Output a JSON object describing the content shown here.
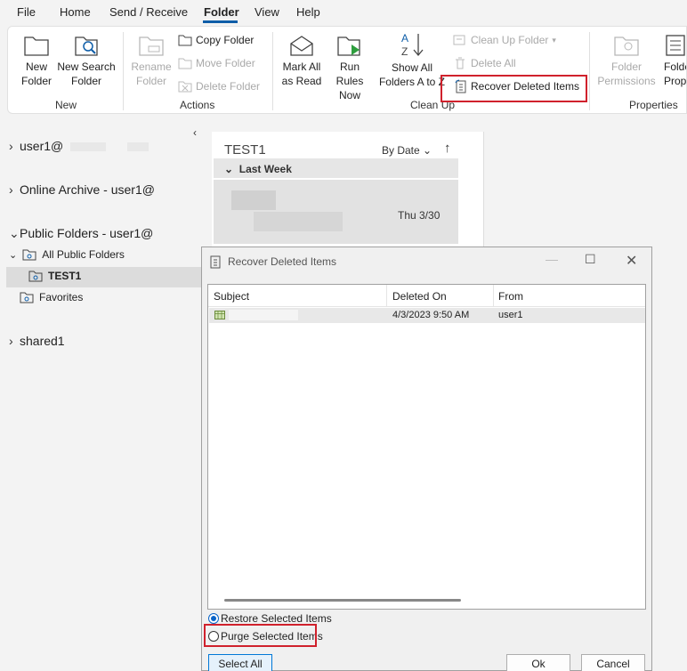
{
  "menu": {
    "items": [
      "File",
      "Home",
      "Send / Receive",
      "Folder",
      "View",
      "Help"
    ],
    "active": "Folder"
  },
  "ribbon": {
    "new_group": {
      "new_folder": [
        "New",
        "Folder"
      ],
      "new_search_folder": [
        "New Search",
        "Folder"
      ],
      "label": "New"
    },
    "actions_group": {
      "rename_folder": [
        "Rename",
        "Folder"
      ],
      "copy_folder": "Copy Folder",
      "move_folder": "Move Folder",
      "delete_folder": "Delete Folder",
      "label": "Actions"
    },
    "cleanup_group": {
      "mark_all_read": [
        "Mark All",
        "as Read"
      ],
      "run_rules": [
        "Run Rules",
        "Now"
      ],
      "show_all_folders": [
        "Show All",
        "Folders A to Z"
      ],
      "clean_up_folder": "Clean Up Folder",
      "delete_all": "Delete All",
      "recover_deleted": "Recover Deleted Items",
      "label": "Clean Up"
    },
    "properties_group": {
      "folder_permissions": [
        "Folder",
        "Permissions"
      ],
      "folder_properties": [
        "Folder",
        "Properties"
      ],
      "label": "Properties"
    }
  },
  "folders": {
    "account1": "user1@",
    "online_archive": "Online Archive - user1@",
    "public_folders": "Public Folders - user1@",
    "all_public_folders": "All Public Folders",
    "test1": "TEST1",
    "favorites": "Favorites",
    "shared1": "shared1"
  },
  "message_list": {
    "folder_title": "TEST1",
    "sort_by": "By Date",
    "group_header": "Last Week",
    "item_date": "Thu 3/30"
  },
  "dialog": {
    "title": "Recover Deleted Items",
    "columns": [
      "Subject",
      "Deleted On",
      "From"
    ],
    "rows": [
      {
        "subject": "",
        "deleted_on": "4/3/2023 9:50 AM",
        "from": "user1"
      }
    ],
    "options": {
      "restore": "Restore Selected Items",
      "purge": "Purge Selected Items",
      "selected": "restore"
    },
    "buttons": {
      "select_all": "Select All",
      "ok": "Ok",
      "cancel": "Cancel"
    }
  },
  "colors": {
    "accent": "#0f5ea8",
    "highlight_red": "#d0212c",
    "disabled_text": "#a9a9a9"
  }
}
